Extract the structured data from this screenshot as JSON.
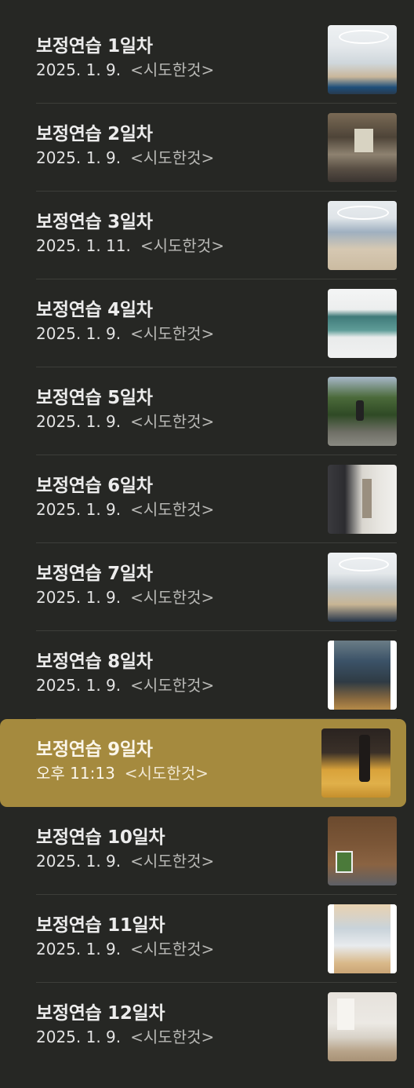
{
  "notes": [
    {
      "title": "보정연습 1일차",
      "date": "2025. 1. 9.",
      "preview": "<시도한것>",
      "thumb": "living-room-photo",
      "selected": false
    },
    {
      "title": "보정연습 2일차",
      "date": "2025. 1. 9.",
      "preview": "<시도한것>",
      "thumb": "study-room-photo",
      "selected": false
    },
    {
      "title": "보정연습 3일차",
      "date": "2025. 1. 11.",
      "preview": "<시도한것>",
      "thumb": "living-room-photo",
      "selected": false
    },
    {
      "title": "보정연습 4일차",
      "date": "2025. 1. 9.",
      "preview": "<시도한것>",
      "thumb": "window-room-photo",
      "selected": false
    },
    {
      "title": "보정연습 5일차",
      "date": "2025. 1. 9.",
      "preview": "<시도한것>",
      "thumb": "park-path-photo",
      "selected": false
    },
    {
      "title": "보정연습 6일차",
      "date": "2025. 1. 9.",
      "preview": "<시도한것>",
      "thumb": "kitchen-photo",
      "selected": false
    },
    {
      "title": "보정연습 7일차",
      "date": "2025. 1. 9.",
      "preview": "<시도한것>",
      "thumb": "living-room-photo",
      "selected": false
    },
    {
      "title": "보정연습 8일차",
      "date": "2025. 1. 9.",
      "preview": "<시도한것>",
      "thumb": "worker-photo",
      "selected": false
    },
    {
      "title": "보정연습 9일차",
      "date": "오후 11:13",
      "preview": "<시도한것>",
      "thumb": "bottles-photo",
      "selected": true
    },
    {
      "title": "보정연습 10일차",
      "date": "2025. 1. 9.",
      "preview": "<시도한것>",
      "thumb": "wood-room-photo",
      "selected": false
    },
    {
      "title": "보정연습 11일차",
      "date": "2025. 1. 9.",
      "preview": "<시도한것>",
      "thumb": "shelf-room-photo",
      "selected": false
    },
    {
      "title": "보정연습 12일차",
      "date": "2025. 1. 9.",
      "preview": "<시도한것>",
      "thumb": "bedroom-photo",
      "selected": false
    }
  ],
  "colors": {
    "background": "#262724",
    "selected": "#a58a3e",
    "divider": "#3d3e3a",
    "title": "#ececec",
    "preview": "#b9b9b6"
  }
}
